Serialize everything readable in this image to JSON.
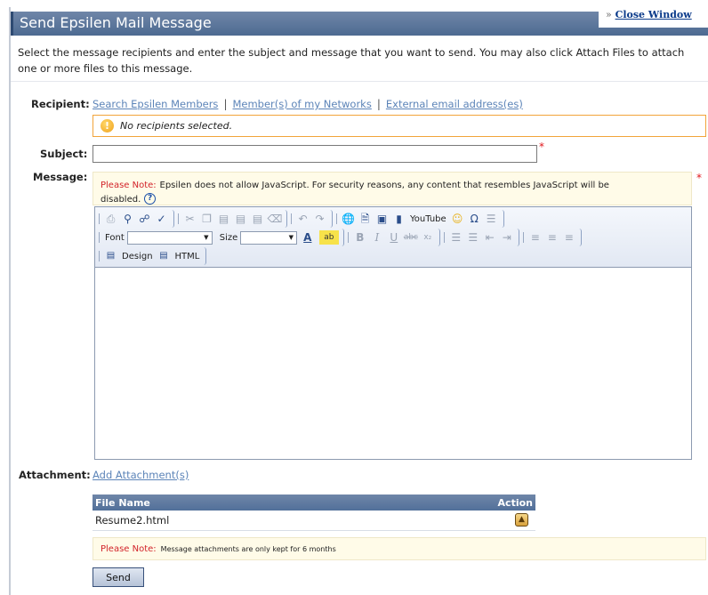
{
  "header": {
    "title": "Send Epsilen Mail Message",
    "close_prefix": "»",
    "close_label": "Close Window"
  },
  "intro": "Select the message recipients and enter the subject and message that you want to send. You may also click Attach Files to attach one or more files to this message.",
  "recipient": {
    "label": "Recipient:",
    "links": [
      "Search Epsilen Members",
      "Member(s) of my Networks",
      "External email address(es)"
    ],
    "separator": "|",
    "empty_message": "No recipients selected."
  },
  "subject": {
    "label": "Subject:",
    "value": "",
    "required_mark": "*"
  },
  "message": {
    "label": "Message:",
    "required_mark": "*",
    "note_label": "Please Note:",
    "note_text": "Epsilen does not allow JavaScript. For security reasons, any content that resembles JavaScript will be disabled.",
    "help_glyph": "?"
  },
  "toolbar": {
    "font_label": "Font",
    "size_label": "Size",
    "youtube_label": "YouTube",
    "design_label": "Design",
    "html_label": "HTML"
  },
  "attachment": {
    "label": "Attachment:",
    "add_link": "Add Attachment(s)",
    "columns": [
      "File Name",
      "Action"
    ],
    "files": [
      {
        "name": "Resume2.html"
      }
    ],
    "note_label": "Please Note:",
    "note_text": "Message attachments are only kept for 6 months"
  },
  "send_label": "Send",
  "colors": {
    "header_bg": "#5b7599",
    "link": "#5c84b8",
    "required": "#e0161b",
    "note_bg": "#fffbe8",
    "warn_border": "#f2a43a"
  }
}
